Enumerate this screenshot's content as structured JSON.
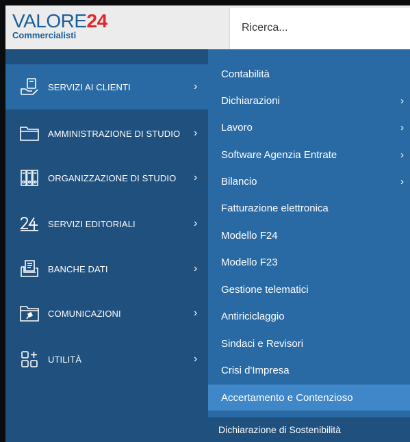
{
  "header": {
    "logo_primary": "VALORE",
    "logo_number": "24",
    "logo_secondary": "Commercialisti",
    "search_placeholder": "Ricerca..."
  },
  "left_menu": {
    "items": [
      {
        "label": "SERVIZI AI CLIENTI",
        "icon": "client-services-icon",
        "active": true
      },
      {
        "label": "AMMINISTRAZIONE DI STUDIO",
        "icon": "folder-icon"
      },
      {
        "label": "ORGANIZZAZIONE DI STUDIO",
        "icon": "binders-icon"
      },
      {
        "label": "SERVIZI EDITORIALI",
        "icon": "twentyfour-icon"
      },
      {
        "label": "BANCHE DATI",
        "icon": "database-icon"
      },
      {
        "label": "COMUNICAZIONI",
        "icon": "pinned-folder-icon"
      },
      {
        "label": "UTILITÀ",
        "icon": "apps-add-icon"
      }
    ]
  },
  "sub_menu": {
    "items": [
      {
        "label": "Contabilità",
        "has_submenu": false
      },
      {
        "label": "Dichiarazioni",
        "has_submenu": true
      },
      {
        "label": "Lavoro",
        "has_submenu": true
      },
      {
        "label": "Software Agenzia Entrate",
        "has_submenu": true
      },
      {
        "label": "Bilancio",
        "has_submenu": true
      },
      {
        "label": "Fatturazione elettronica",
        "has_submenu": false
      },
      {
        "label": "Modello F24",
        "has_submenu": false
      },
      {
        "label": "Modello F23",
        "has_submenu": false
      },
      {
        "label": "Gestione telematici",
        "has_submenu": false
      },
      {
        "label": "Antiriciclaggio",
        "has_submenu": false
      },
      {
        "label": "Sindaci e Revisori",
        "has_submenu": false
      },
      {
        "label": "Crisi d'Impresa",
        "has_submenu": false
      },
      {
        "label": "Accertamento e Contenzioso",
        "has_submenu": false,
        "highlighted": true
      }
    ],
    "extra_item": "Dichiarazione di Sostenibilità"
  },
  "chevron_glyph": "›",
  "colors": {
    "left_menu_bg": "#20507e",
    "sub_menu_bg": "#2a6aa4",
    "highlight_bg": "#3f87c8",
    "brand_red": "#e3262d",
    "brand_blue": "#1d5f99"
  }
}
